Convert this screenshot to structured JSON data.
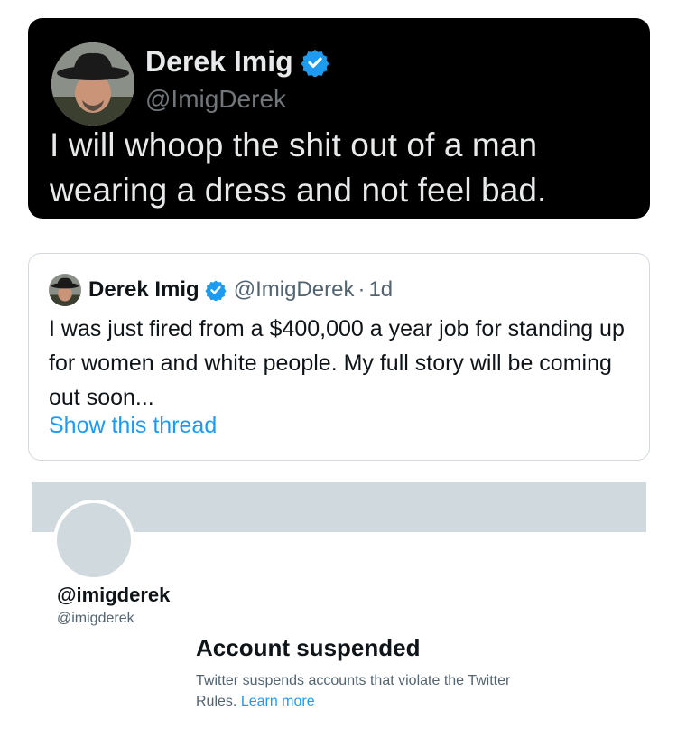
{
  "main_tweet": {
    "name": "Derek Imig",
    "handle": "@ImigDerek",
    "text": "I will whoop the shit out of a man wearing a dress and not feel bad.",
    "verified_icon": "verified-badge-icon",
    "avatar_icon": "profile-photo"
  },
  "quoted_tweet": {
    "name": "Derek Imig",
    "handle": "@ImigDerek",
    "separator": "·",
    "time": "1d",
    "text": "I was just fired from a $400,000 a year job for standing up for women and white people.  My full story will be coming out soon...",
    "link": "Show this thread"
  },
  "profile": {
    "display_name": "@imigderek",
    "handle": "@imigderek",
    "status_title": "Account suspended",
    "status_message": "Twitter suspends accounts that violate the Twitter Rules.",
    "learn_more": "Learn more"
  },
  "colors": {
    "dark_bg": "#000000",
    "link_blue": "#1d9bf0",
    "verified_blue": "#1d9bf0",
    "banner_gray": "#cfd9de"
  }
}
